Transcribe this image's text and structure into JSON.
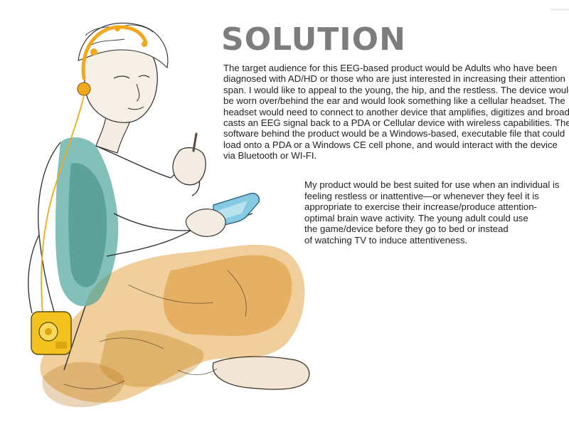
{
  "title": "SOLUTION",
  "paragraph1": [
    "The target audience for this EEG-based product would be Adults who have been",
    "diagnosed with AD/HD or those who are just interested in increasing their attention",
    "span. I would like to appeal to the young, the hip, and the restless. The device would",
    "be worn over/behind the ear and would look something like a cellular headset. The",
    "headset would need to connect to another device that amplifies, digitizes and broad-",
    "casts an EEG signal back to a PDA or Cellular device with wireless capabilities. The",
    "software behind the product would be a Windows-based, executable file that could",
    "load onto a PDA or a Windows CE cell phone, and would interact with the device",
    "via Bluetooth or WI-FI."
  ],
  "paragraph2": [
    "My product would be best suited for use when an individual is",
    "feeling restless or inattentive—or whenever they feel it is",
    "appropriate to exercise their increase/produce attention-",
    "optimal brain wave activity. The young adult could use",
    "the game/device before they go to bed or instead",
    "of watching TV to induce attentiveness."
  ],
  "colors": {
    "title": "#7d7d7d",
    "text": "#222222",
    "headset": "#f2a81c",
    "tank_top": "#3f9e94",
    "pants": "#e0992f",
    "pda_screen": "#86c9e2",
    "device": "#f3c21f"
  }
}
